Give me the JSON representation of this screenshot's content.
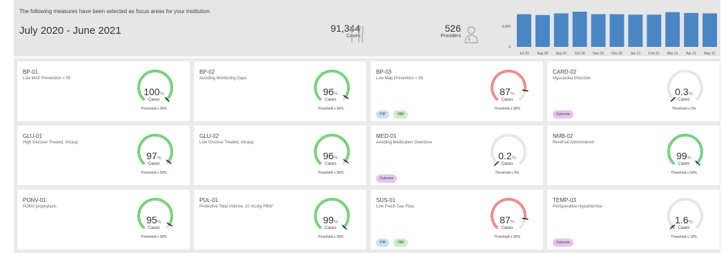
{
  "header": {
    "intro": "The following measures have been selected as focus areas for your institution.",
    "period": "July 2020 - June 2021",
    "cases": {
      "value": "91,344",
      "label": "Cases",
      "icon": "surgical-tools-icon"
    },
    "providers": {
      "value": "526",
      "label": "Providers",
      "icon": "provider-icon"
    }
  },
  "chart_data": {
    "type": "bar",
    "categories": [
      "Jul 20",
      "Aug 20",
      "Sep 20",
      "Oct 20",
      "Nov 20",
      "Dec 20",
      "Jan 21",
      "Feb 21",
      "Mar 21",
      "Apr 21",
      "May 21"
    ],
    "values": [
      7900,
      7700,
      8100,
      8500,
      7900,
      7900,
      7800,
      7800,
      8400,
      8200,
      8100
    ],
    "y_ticks": [
      "5,000",
      "0"
    ],
    "ylim": [
      0,
      9000
    ],
    "color": "#4a86c6"
  },
  "colors": {
    "good": "#7dcf7d",
    "bad": "#f08c8c",
    "neutral": "#e6e6e6"
  },
  "cards": [
    {
      "code": "BP-01",
      "desc": "Low MAP Prevention < 55",
      "value": "100",
      "pct": "%",
      "cases": "Cases",
      "threshold": "Threshold ≥ 90%",
      "fraction": 1.0,
      "status": "good",
      "tags": []
    },
    {
      "code": "BP-02",
      "desc": "Avoiding Monitoring Gaps",
      "value": "96",
      "pct": "%",
      "cases": "Cases",
      "threshold": "Threshold ≥ 90%",
      "fraction": 0.96,
      "status": "good",
      "tags": []
    },
    {
      "code": "BP-03",
      "desc": "Low Map Prevention < 65",
      "value": "87",
      "pct": "%",
      "cases": "Cases",
      "threshold": "Threshold ≥ 90%",
      "fraction": 0.87,
      "status": "bad",
      "tags": [
        "P4P",
        "VBR"
      ]
    },
    {
      "code": "CARD-02",
      "desc": "Myocardial Infarction",
      "value": "0.3",
      "pct": "%",
      "cases": "Cases",
      "threshold": "Threshold ≤ 5%",
      "fraction": 0.003,
      "status": "good",
      "tags": [
        "Outcome"
      ]
    },
    {
      "code": "GLU-01",
      "desc": "High Glucose Treated, Intraop",
      "value": "97",
      "pct": "%",
      "cases": "Cases",
      "threshold": "Threshold ≥ 90%",
      "fraction": 0.97,
      "status": "good",
      "tags": []
    },
    {
      "code": "GLU-02",
      "desc": "Low Glucose Treated, Intraop",
      "value": "96",
      "pct": "%",
      "cases": "Cases",
      "threshold": "Threshold ≥ 90%",
      "fraction": 0.96,
      "status": "good",
      "tags": []
    },
    {
      "code": "MED-01",
      "desc": "Avoiding Medication Overdose",
      "value": "0.2",
      "pct": "%",
      "cases": "Cases",
      "threshold": "Threshold ≤ 5%",
      "fraction": 0.002,
      "status": "good",
      "tags": [
        "Outcome"
      ]
    },
    {
      "code": "NMB-02",
      "desc": "Reversal Administered",
      "value": "99",
      "pct": "%",
      "cases": "Cases",
      "threshold": "Threshold ≥ 90%",
      "fraction": 0.99,
      "status": "good",
      "tags": []
    },
    {
      "code": "PONV-01",
      "desc": "PONV prophylaxis",
      "value": "95",
      "pct": "%",
      "cases": "Cases",
      "threshold": "Threshold ≥ 90%",
      "fraction": 0.95,
      "status": "good",
      "tags": []
    },
    {
      "code": "PUL-01",
      "desc": "Protective Tidal Volume, 10 mL/kg PBW",
      "value": "99",
      "pct": "%",
      "cases": "Cases",
      "threshold": "Threshold ≥ 90%",
      "fraction": 0.99,
      "status": "good",
      "tags": []
    },
    {
      "code": "SUS-01",
      "desc": "Low Fresh Gas Flow",
      "value": "87",
      "pct": "%",
      "cases": "Cases",
      "threshold": "Threshold ≥ 90%",
      "fraction": 0.87,
      "status": "bad",
      "tags": [
        "P4P",
        "VBR"
      ]
    },
    {
      "code": "TEMP-03",
      "desc": "Perioperative Hypothermia",
      "value": "1.6",
      "pct": "%",
      "cases": "Cases",
      "threshold": "Threshold ≤ 10%",
      "fraction": 0.016,
      "status": "good",
      "tags": [
        "Outcome"
      ]
    }
  ],
  "tag_colors": {
    "P4P": "#c9e3f5",
    "VBR": "#c9efc9",
    "Outcome": "#e3c6ef"
  }
}
